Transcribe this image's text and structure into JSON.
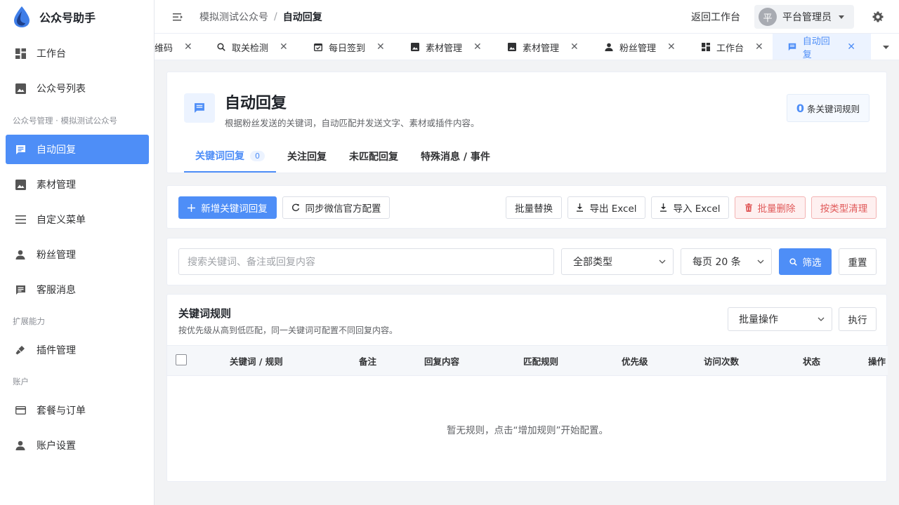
{
  "brand": {
    "name": "公众号助手"
  },
  "sidebar": {
    "items_top": [
      {
        "label": "工作台",
        "icon": "dashboard-icon"
      },
      {
        "label": "公众号列表",
        "icon": "image-icon"
      }
    ],
    "section_account": "公众号管理 · 模拟测试公众号",
    "items_account": [
      {
        "label": "自动回复",
        "icon": "message-icon",
        "active": true
      },
      {
        "label": "素材管理",
        "icon": "image-icon"
      },
      {
        "label": "自定义菜单",
        "icon": "menu-icon"
      },
      {
        "label": "粉丝管理",
        "icon": "person-icon"
      },
      {
        "label": "客服消息",
        "icon": "chat-icon"
      }
    ],
    "section_ext": "扩展能力",
    "items_ext": [
      {
        "label": "插件管理",
        "icon": "plugin-icon"
      }
    ],
    "section_user": "账户",
    "items_user": [
      {
        "label": "套餐与订单",
        "icon": "card-icon"
      },
      {
        "label": "账户设置",
        "icon": "person-icon"
      }
    ]
  },
  "header": {
    "breadcrumb_parent": "模拟测试公众号",
    "breadcrumb_sep": "/",
    "breadcrumb_current": "自动回复",
    "back_label": "返回工作台",
    "avatar_text": "平",
    "user_name": "平台管理员"
  },
  "tabs": [
    {
      "label": "维码",
      "icon": ""
    },
    {
      "label": "取关检测",
      "icon": "search-icon"
    },
    {
      "label": "每日签到",
      "icon": "calendar-icon"
    },
    {
      "label": "素材管理",
      "icon": "image-icon"
    },
    {
      "label": "素材管理",
      "icon": "image-icon"
    },
    {
      "label": "粉丝管理",
      "icon": "person-icon"
    },
    {
      "label": "工作台",
      "icon": "dashboard-icon"
    },
    {
      "label": "自动回复",
      "icon": "message-icon",
      "active": true
    }
  ],
  "page": {
    "title": "自动回复",
    "subtitle": "根据粉丝发送的关键词，自动匹配并发送文字、素材或插件内容。",
    "rule_count": "0",
    "rule_count_suffix": "条关键词规则",
    "sub_tabs": [
      {
        "label": "关键词回复",
        "badge": "0",
        "active": true
      },
      {
        "label": "关注回复"
      },
      {
        "label": "未匹配回复"
      },
      {
        "label": "特殊消息 / 事件"
      }
    ]
  },
  "toolbar": {
    "add": "新增关键词回复",
    "sync": "同步微信官方配置",
    "batch_replace": "批量替换",
    "export": "导出 Excel",
    "import": "导入 Excel",
    "batch_delete": "批量删除",
    "clean_by_type": "按类型清理"
  },
  "filter": {
    "search_placeholder": "搜索关键词、备注或回复内容",
    "type_value": "全部类型",
    "page_size_value": "每页 20 条",
    "filter_btn": "筛选",
    "reset_btn": "重置"
  },
  "table": {
    "title": "关键词规则",
    "subtitle": "按优先级从高到低匹配，同一关键词可配置不同回复内容。",
    "batch_value": "批量操作",
    "execute": "执行",
    "columns": [
      "关键词 / 规则",
      "备注",
      "回复内容",
      "匹配规则",
      "优先级",
      "访问次数",
      "状态",
      "操作"
    ],
    "empty_text": "暂无规则，点击“增加规则”开始配置。"
  },
  "colors": {
    "accent": "#4e8ef7",
    "danger": "#e05a5a"
  }
}
